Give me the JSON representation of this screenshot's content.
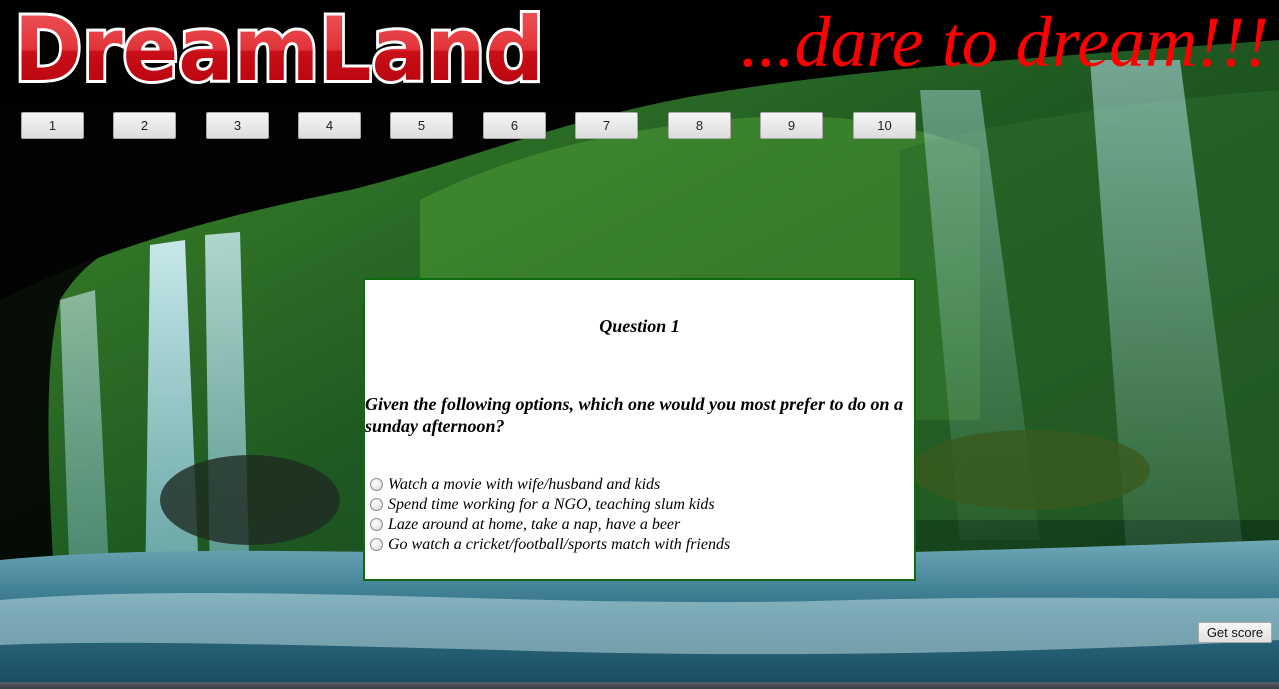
{
  "header": {
    "logo_text": "DreamLand",
    "tagline": "...dare to dream!!!"
  },
  "nav": {
    "buttons": [
      "1",
      "2",
      "3",
      "4",
      "5",
      "6",
      "7",
      "8",
      "9",
      "10"
    ]
  },
  "question": {
    "title": "Question 1",
    "text": "Given the following options, which one would you most prefer to do on a sunday afternoon?",
    "options": [
      "Watch a movie with wife/husband and kids",
      "Spend time working for a NGO, teaching slum kids",
      "Laze around at home, take a nap, have a beer",
      "Go watch a cricket/football/sports match with friends"
    ]
  },
  "actions": {
    "score_label": "Get score"
  },
  "colors": {
    "tagline": "#ff0000",
    "logo": "#d9141c",
    "question_border": "#0e6b0e"
  }
}
